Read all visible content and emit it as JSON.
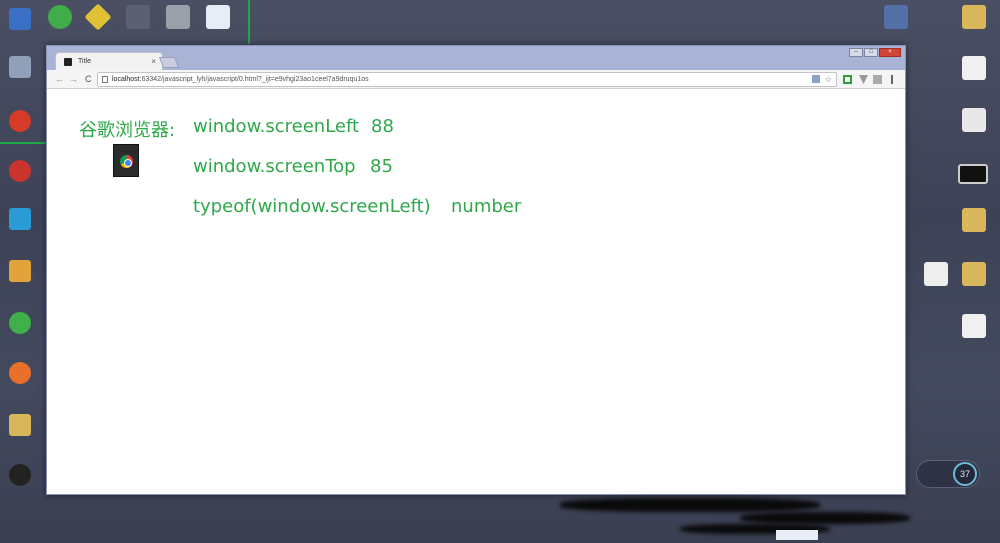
{
  "browser": {
    "tab_title": "Title",
    "tab_close": "×",
    "url_host": "localhost",
    "url_rest": ":63342/javascript_lyh/javascript/0.html?_ijt=e9vhgi23ao1ceel7a9druqu1os",
    "nav": {
      "back": "←",
      "forward": "→",
      "reload": "C"
    },
    "star": "☆",
    "window_controls": {
      "minimize": "–",
      "maximize": "□",
      "close": "×"
    }
  },
  "content": {
    "lines": [
      {
        "prefix": "谷歌浏览器:",
        "expr": "window.screenLeft",
        "value": "88"
      },
      {
        "prefix": "",
        "expr": "window.screenTop",
        "value": "85"
      },
      {
        "prefix": "",
        "expr": "typeof(window.screenLeft)",
        "value": "number"
      }
    ],
    "text_color": "#2fa84a"
  },
  "widget": {
    "ring_text": "37"
  },
  "icons": {
    "tab_favicon": "page-icon",
    "chrome": "chrome-icon"
  }
}
